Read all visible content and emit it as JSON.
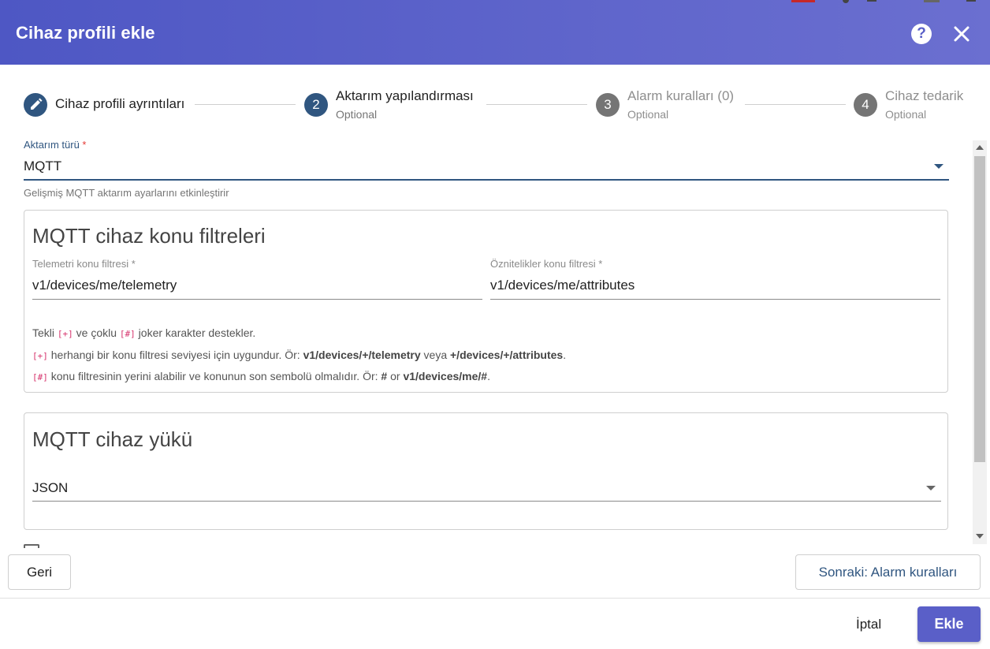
{
  "dialog": {
    "title": "Cihaz profili ekle",
    "help_symbol": "?"
  },
  "stepper": {
    "steps": [
      {
        "number": "",
        "label": "Cihaz profili ayrıntıları",
        "sub": ""
      },
      {
        "number": "2",
        "label": "Aktarım yapılandırması",
        "sub": "Optional"
      },
      {
        "number": "3",
        "label": "Alarm kuralları (0)",
        "sub": "Optional"
      },
      {
        "number": "4",
        "label": "Cihaz tedarik",
        "sub": "Optional"
      }
    ]
  },
  "transport": {
    "label": "Aktarım türü",
    "required_mark": "*",
    "value": "MQTT",
    "hint": "Gelişmiş MQTT aktarım ayarlarını etkinleştirir"
  },
  "mqtt_filters": {
    "title": "MQTT cihaz konu filtreleri",
    "telemetry_label": "Telemetri konu filtresi *",
    "telemetry_value": "v1/devices/me/telemetry",
    "attributes_label": "Öznitelikler konu filtresi *",
    "attributes_value": "v1/devices/me/attributes",
    "info": {
      "line1_a": "Tekli ",
      "code_plus": "[+]",
      "line1_b": " ve çoklu ",
      "code_hash": "[#]",
      "line1_c": " joker karakter destekler.",
      "line2_a": " herhangi bir konu filtresi seviyesi için uygundur. Ör: ",
      "line2_b": "v1/devices/+/telemetry",
      "line2_c": " veya ",
      "line2_d": "+/devices/+/attributes",
      "line2_e": ".",
      "line3_a": " konu filtresinin yerini alabilir ve konunun son sembolü olmalıdır. Ör: ",
      "line3_b": "#",
      "line3_c": " or ",
      "line3_d": "v1/devices/me/#",
      "line3_e": "."
    }
  },
  "mqtt_payload": {
    "title": "MQTT cihaz yükü",
    "value": "JSON"
  },
  "buttons": {
    "back": "Geri",
    "next": "Sonraki: Alarm kuralları",
    "cancel": "İptal",
    "add": "Ekle"
  },
  "colors": {
    "header_start": "#4e57c4",
    "header_end": "#6b6fd0",
    "primary": "#305680",
    "add_button": "#5a5fc8",
    "required": "#e53935",
    "code": "#d6336c"
  }
}
